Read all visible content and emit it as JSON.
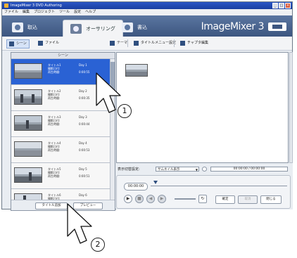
{
  "window": {
    "title": "ImageMixer 3 DVD Authoring",
    "controls": [
      "_",
      "□",
      "×"
    ]
  },
  "menubar": [
    "ファイル",
    "編集",
    "プロジェクト",
    "ツール",
    "設定",
    "ヘルプ"
  ],
  "modes": [
    {
      "label": "取込",
      "icon": "import-icon"
    },
    {
      "label": "オーサリング",
      "icon": "authoring-icon",
      "active": true
    },
    {
      "label": "書込",
      "icon": "burn-icon"
    }
  ],
  "brand": "ImageMixer 3",
  "toolbar": {
    "left": [
      {
        "label": "シーン",
        "highlight": true
      },
      {
        "label": "ファイル"
      }
    ],
    "right": [
      {
        "label": "テーマ"
      },
      {
        "label": "タイトルメニュー設定"
      },
      {
        "label": "チャプタ編集"
      }
    ]
  },
  "left_panel": {
    "header": "シーン",
    "items": [
      {
        "title": "タイトル1",
        "day": "Day 1",
        "meta1": "撮影日付:",
        "meta2": "再生時間:",
        "time": "0:00:55",
        "selected": true
      },
      {
        "title": "タイトル2",
        "day": "Day 2",
        "meta1": "撮影日付:",
        "meta2": "再生時間:",
        "time": "0:00:35"
      },
      {
        "title": "タイトル3",
        "day": "Day 3",
        "meta1": "撮影日付:",
        "meta2": "再生時間:",
        "time": "0:00:44"
      },
      {
        "title": "タイトル4",
        "day": "Day 4",
        "meta1": "撮影日付:",
        "meta2": "再生時間:",
        "time": "0:00:53"
      },
      {
        "title": "タイトル5",
        "day": "Day 5",
        "meta1": "撮影日付:",
        "meta2": "再生時間:",
        "time": "0:00:51"
      },
      {
        "title": "タイトル6",
        "day": "Day 6",
        "meta1": "撮影日付:",
        "meta2": "再生時間:",
        "time": ""
      }
    ],
    "buttons": {
      "add_title": "タイトル追加",
      "preview": "プレビュー"
    }
  },
  "right_panel": {
    "display_label": "表示切替設定:",
    "display_select": "サムネイル表示",
    "time_display": "00:00:00 / 00:00:00",
    "timecode": "00:00:00",
    "buttons": {
      "confirm": "確定",
      "cancel": "取消",
      "close": "閉じる"
    }
  },
  "callouts": [
    "1",
    "2"
  ]
}
